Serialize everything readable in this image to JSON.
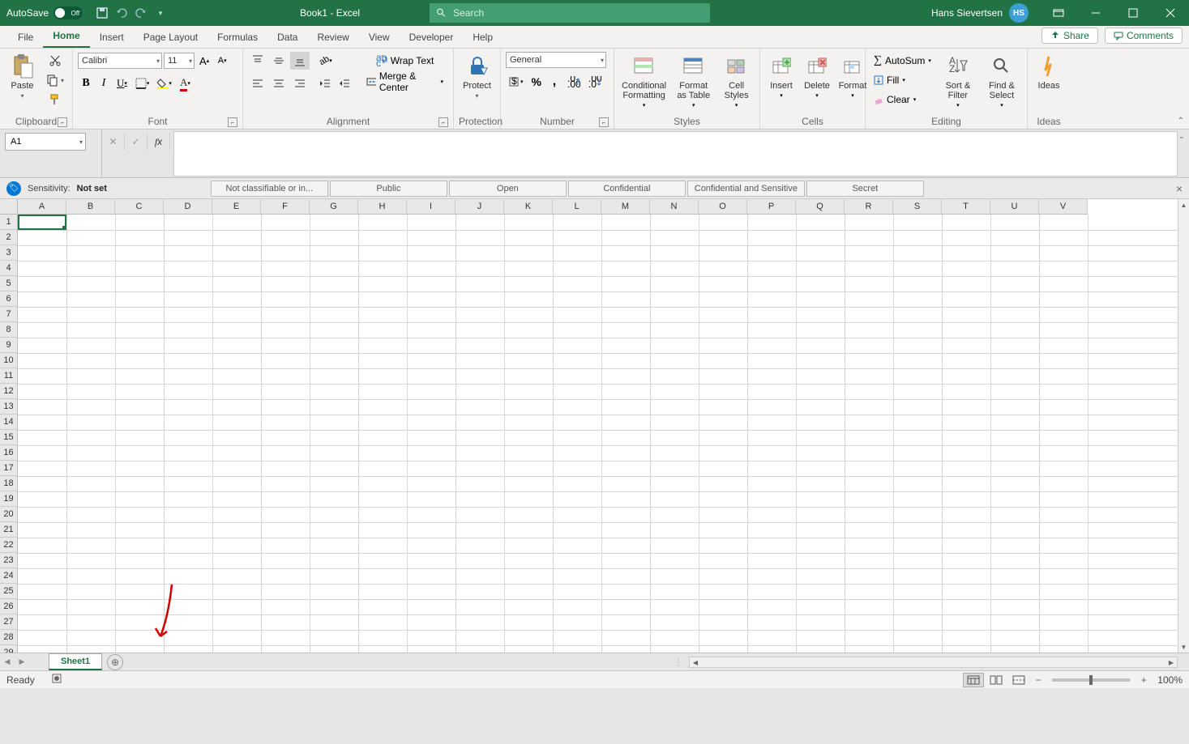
{
  "titlebar": {
    "autosave_label": "AutoSave",
    "autosave_state": "Off",
    "doc_title": "Book1  -  Excel",
    "search_placeholder": "Search",
    "username": "Hans Sievertsen",
    "user_initials": "HS"
  },
  "tabs": {
    "items": [
      "File",
      "Home",
      "Insert",
      "Page Layout",
      "Formulas",
      "Data",
      "Review",
      "View",
      "Developer",
      "Help"
    ],
    "active": "Home",
    "share": "Share",
    "comments": "Comments"
  },
  "ribbon": {
    "clipboard": {
      "title": "Clipboard",
      "paste": "Paste"
    },
    "font": {
      "title": "Font",
      "name": "Calibri",
      "size": "11"
    },
    "alignment": {
      "title": "Alignment",
      "wrap": "Wrap Text",
      "merge": "Merge & Center"
    },
    "protection": {
      "title": "Protection",
      "protect": "Protect"
    },
    "number": {
      "title": "Number",
      "format": "General"
    },
    "styles": {
      "title": "Styles",
      "cond": "Conditional Formatting",
      "fat": "Format as Table",
      "cell": "Cell Styles"
    },
    "cells": {
      "title": "Cells",
      "insert": "Insert",
      "delete": "Delete",
      "format": "Format"
    },
    "editing": {
      "title": "Editing",
      "autosum": "AutoSum",
      "fill": "Fill",
      "clear": "Clear",
      "sort": "Sort & Filter",
      "find": "Find & Select"
    },
    "ideas": {
      "title": "Ideas",
      "ideas": "Ideas"
    }
  },
  "fx": {
    "namebox": "A1",
    "formula": ""
  },
  "sensitivity": {
    "label": "Sensitivity:",
    "value": "Not set",
    "buttons": [
      "Not classifiable or in...",
      "Public",
      "Open",
      "Confidential",
      "Confidential and Sensitive",
      "Secret"
    ]
  },
  "grid": {
    "columns": [
      "A",
      "B",
      "C",
      "D",
      "E",
      "F",
      "G",
      "H",
      "I",
      "J",
      "K",
      "L",
      "M",
      "N",
      "O",
      "P",
      "Q",
      "R",
      "S",
      "T",
      "U",
      "V"
    ],
    "row_count": 29,
    "selected": "A1"
  },
  "sheets": {
    "active": "Sheet1"
  },
  "status": {
    "ready": "Ready",
    "zoom": "100%"
  }
}
